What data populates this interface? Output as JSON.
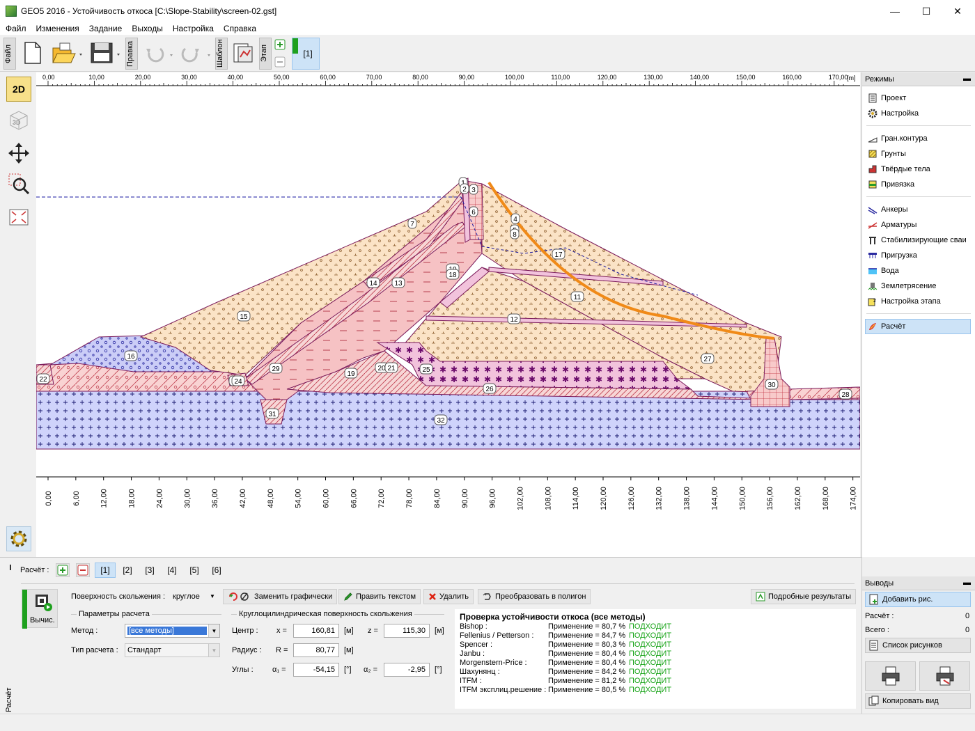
{
  "window": {
    "title": "GEO5 2016 - Устойчивость откоса [C:\\Slope-Stability\\screen-02.gst]",
    "min": "—",
    "max": "☐",
    "close": "✕"
  },
  "menu": [
    "Файл",
    "Изменения",
    "Задание",
    "Выходы",
    "Настройка",
    "Справка"
  ],
  "toolbar": {
    "file_label": "Файл",
    "edit_label": "Правка",
    "template_label": "Шаблон",
    "stage_label": "Этап",
    "stage_tab": "[1]"
  },
  "lefttools": {
    "btn_2d": "2D",
    "btn_3d": "3D"
  },
  "ruler": {
    "top": [
      "0,00",
      "10,00",
      "20,00",
      "30,00",
      "40,00",
      "50,00",
      "60,00",
      "70,00",
      "80,00",
      "90,00",
      "100,00",
      "110,00",
      "120,00",
      "130,00",
      "140,00",
      "150,00",
      "160,00",
      "170,00"
    ],
    "unit": "[m]",
    "bottom": [
      "0,00",
      "6,00",
      "12,00",
      "18,00",
      "24,00",
      "30,00",
      "36,00",
      "42,00",
      "48,00",
      "54,00",
      "60,00",
      "66,00",
      "72,00",
      "78,00",
      "84,00",
      "90,00",
      "96,00",
      "102,00",
      "108,00",
      "114,00",
      "120,00",
      "126,00",
      "132,00",
      "138,00",
      "144,00",
      "150,00",
      "156,00",
      "162,00",
      "168,00",
      "174,00"
    ]
  },
  "regions": [
    "1",
    "2",
    "3",
    "4",
    "5",
    "6",
    "7",
    "8",
    "9",
    "10",
    "11",
    "12",
    "13",
    "14",
    "15",
    "16",
    "17",
    "18",
    "19",
    "20",
    "21",
    "22",
    "23",
    "24",
    "25",
    "26",
    "27",
    "28",
    "29",
    "30",
    "31",
    "32"
  ],
  "modes": {
    "header": "Режимы",
    "pin": "▬",
    "groups": [
      [
        {
          "label": "Проект",
          "icon": "doc"
        },
        {
          "label": "Настройка",
          "icon": "gear"
        }
      ],
      [
        {
          "label": "Гран.контура",
          "icon": "line"
        },
        {
          "label": "Грунты",
          "icon": "soil"
        },
        {
          "label": "Твёрдые тела",
          "icon": "solid"
        },
        {
          "label": "Привязка",
          "icon": "assign"
        }
      ],
      [
        {
          "label": "Анкеры",
          "icon": "anchor"
        },
        {
          "label": "Арматуры",
          "icon": "rebar"
        },
        {
          "label": "Стабилизирующие сваи",
          "icon": "pile"
        },
        {
          "label": "Пригрузка",
          "icon": "load"
        },
        {
          "label": "Вода",
          "icon": "water"
        },
        {
          "label": "Землетрясение",
          "icon": "quake"
        },
        {
          "label": "Настройка этапа",
          "icon": "stage"
        }
      ],
      [
        {
          "label": "Расчёт",
          "icon": "calc",
          "selected": true
        }
      ]
    ]
  },
  "analysis": {
    "side_label": "Расчёт",
    "tabs_label": "Расчёт :",
    "tabs": [
      "[1]",
      "[2]",
      "[3]",
      "[4]",
      "[5]",
      "[6]"
    ],
    "compute_label": "Вычис.",
    "slip_surface_label": "Поверхность скольжения :",
    "slip_surface_value": "круглое",
    "btn_replace": "Заменить графически",
    "btn_edit_text": "Править текстом",
    "btn_delete": "Удалить",
    "btn_to_polygon": "Преобразовать в полигон",
    "btn_detailed": "Подробные результаты",
    "params_title": "Параметры расчета",
    "method_label": "Метод :",
    "method_value": "[все методы]",
    "calc_type_label": "Тип расчета :",
    "calc_type_value": "Стандарт",
    "circ_title": "Круглоцилиндрическая поверхность скольжения",
    "center_label": "Центр :",
    "x_label": "x =",
    "x_value": "160,81",
    "z_label": "z =",
    "z_value": "115,30",
    "radius_label": "Радиус :",
    "r_label": "R =",
    "r_value": "80,77",
    "angles_label": "Углы :",
    "a1_label": "α₁ =",
    "a1_value": "-54,15",
    "a2_label": "α₂ =",
    "a2_value": "-2,95",
    "unit_m": "[м]",
    "unit_deg": "[°]"
  },
  "results": {
    "title": "Проверка устойчивости откоса (все методы)",
    "rows": [
      {
        "method": "Bishop :",
        "value": "Применение = 80,7 %",
        "status": "ПОДХОДИТ"
      },
      {
        "method": "Fellenius / Petterson :",
        "value": "Применение = 84,7 %",
        "status": "ПОДХОДИТ"
      },
      {
        "method": "Spencer :",
        "value": "Применение = 80,3 %",
        "status": "ПОДХОДИТ"
      },
      {
        "method": "Janbu :",
        "value": "Применение = 80,4 %",
        "status": "ПОДХОДИТ"
      },
      {
        "method": "Morgenstern-Price :",
        "value": "Применение = 80,4 %",
        "status": "ПОДХОДИТ"
      },
      {
        "method": "Шахунянц :",
        "value": "Применение = 84,2 %",
        "status": "ПОДХОДИТ"
      },
      {
        "method": "ITFM :",
        "value": "Применение = 81,2 %",
        "status": "ПОДХОДИТ"
      },
      {
        "method": "ITFM эксплиц.решение :",
        "value": "Применение = 80,5 %",
        "status": "ПОДХОДИТ"
      }
    ]
  },
  "outputs": {
    "header": "Выводы",
    "pin": "▬",
    "add_figure": "Добавить рис.",
    "calc_label": "Расчёт :",
    "calc_count": "0",
    "total_label": "Всего :",
    "total_count": "0",
    "figure_list": "Список рисунков",
    "copy_view": "Копировать вид"
  }
}
